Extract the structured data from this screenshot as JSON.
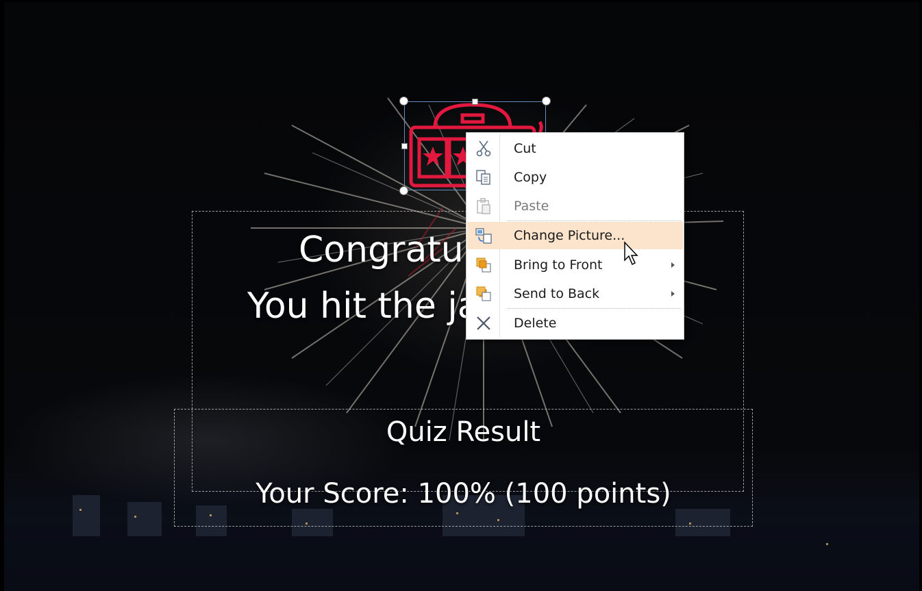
{
  "slide": {
    "headline_line1": "Congratulations!",
    "headline_line2": "You hit the jackpot!",
    "result_title": "Quiz Result",
    "result_score": "Your Score: 100% (100 points)"
  },
  "picture": {
    "icon": "slot-machine-icon",
    "color": "#e3183f"
  },
  "context_menu": {
    "items": [
      {
        "label": "Cut",
        "icon": "scissors-icon"
      },
      {
        "label": "Copy",
        "icon": "copy-icon"
      },
      {
        "label": "Paste",
        "icon": "paste-icon",
        "disabled": true
      },
      {
        "label": "Change Picture...",
        "icon": "change-picture-icon",
        "highlighted": true
      },
      {
        "label": "Bring to Front",
        "icon": "bring-to-front-icon",
        "submenu": true
      },
      {
        "label": "Send to Back",
        "icon": "send-to-back-icon",
        "submenu": true
      },
      {
        "label": "Delete",
        "icon": "delete-icon"
      }
    ],
    "highlight_color": "#fbe3cc"
  }
}
